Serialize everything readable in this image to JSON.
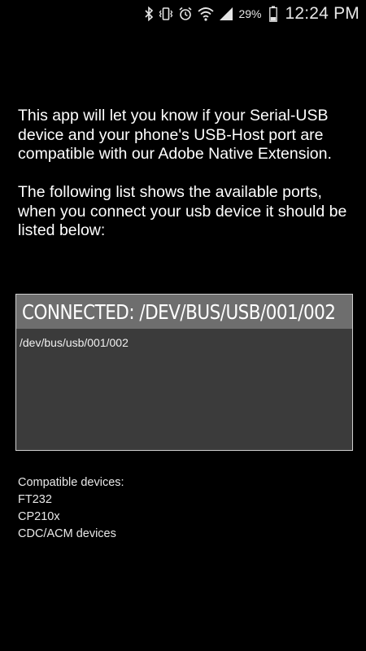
{
  "status_bar": {
    "icons": [
      "bluetooth-icon",
      "vibrate-icon",
      "alarm-icon",
      "wifi-icon",
      "signal-icon"
    ],
    "battery_percent": "29%",
    "battery_icon": "battery-icon",
    "time": "12:24 PM"
  },
  "intro": {
    "paragraph1": "This app will let you know if your Serial-USB device and your phone's USB-Host port are compatible with our Adobe Native Extension.",
    "paragraph2": "The following list shows the available ports, when you connect your usb device it should be listed below:"
  },
  "ports": {
    "header": "CONNECTED: /DEV/BUS/USB/001/002",
    "items": [
      "/dev/bus/usb/001/002"
    ]
  },
  "devices": {
    "heading": "Compatible devices:",
    "items": [
      "FT232",
      "CP210x",
      "CDC/ACM devices"
    ]
  },
  "colors": {
    "background": "#000000",
    "box_background": "#3b3b3b",
    "header_background": "#6e6e6e",
    "box_border": "#cfcfcf",
    "text": "#ffffff"
  }
}
